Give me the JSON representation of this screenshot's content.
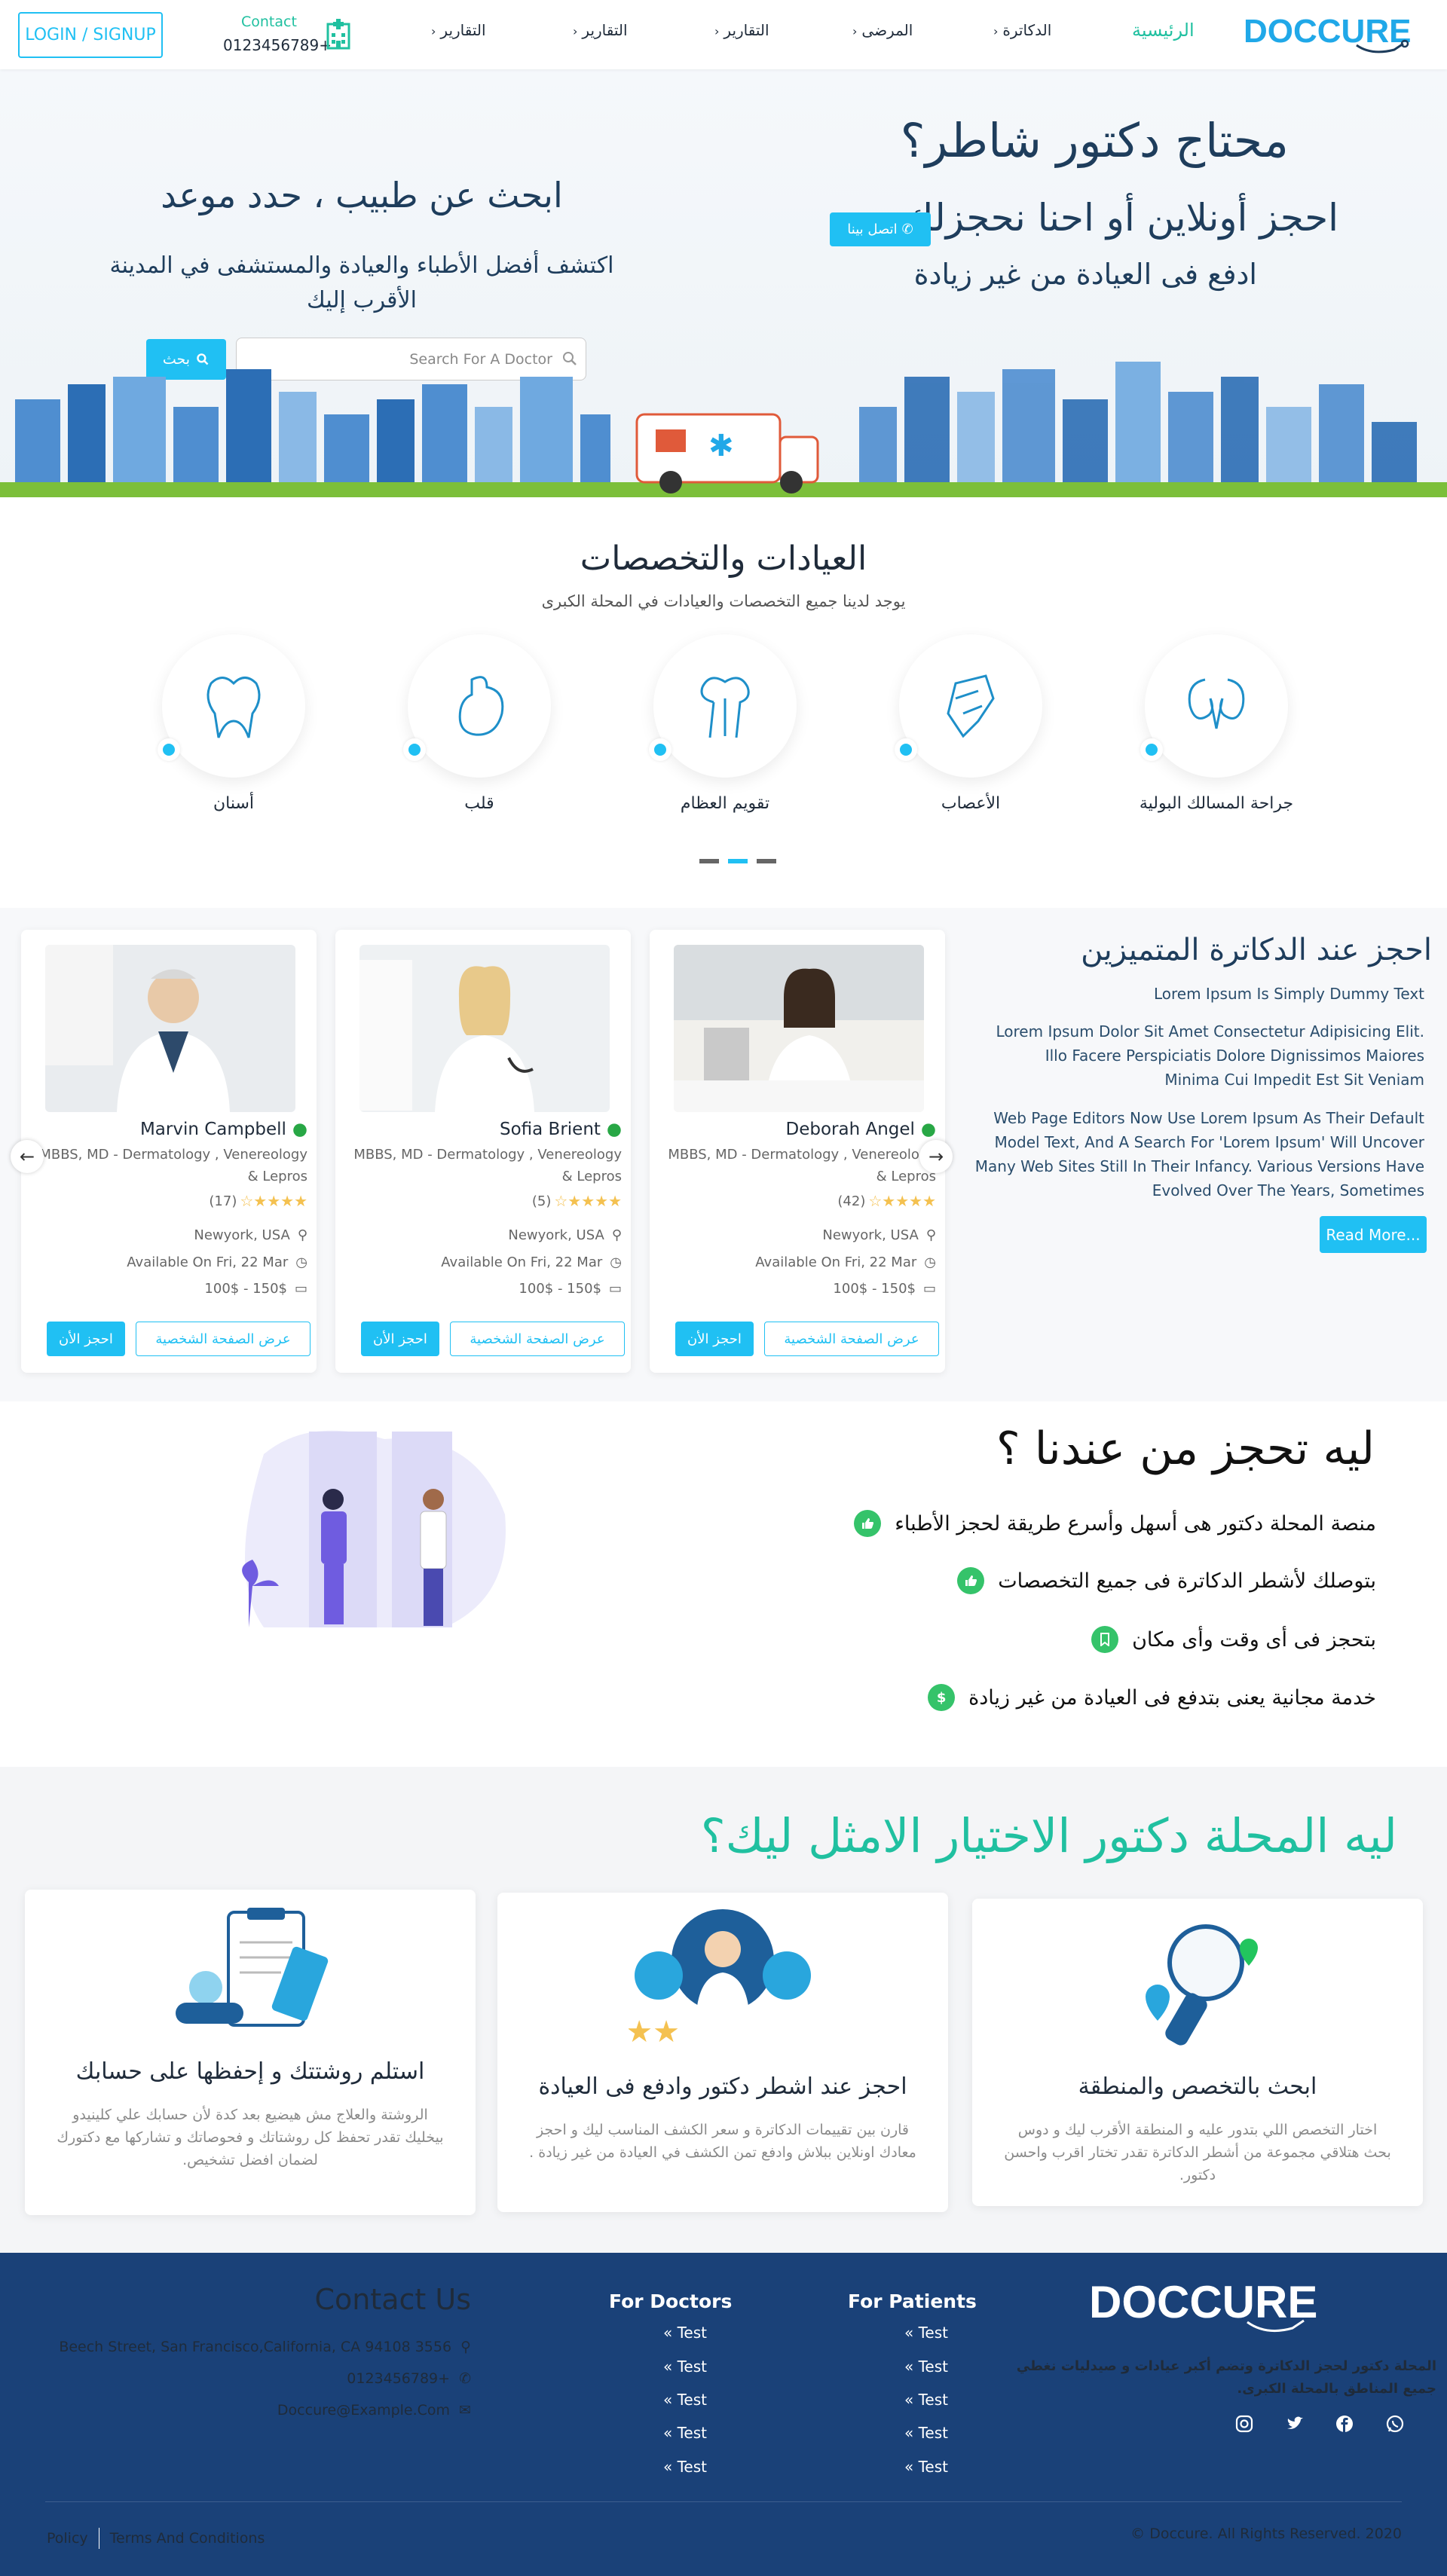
{
  "header": {
    "login_label": "LOGIN / SIGNUP",
    "contact_label": "Contact",
    "contact_phone": "0123456789+",
    "nav": [
      {
        "label": "التقارير"
      },
      {
        "label": "التقارير"
      },
      {
        "label": "التقارير"
      },
      {
        "label": "المرضى"
      },
      {
        "label": "الدكاترة"
      }
    ],
    "home_label": "الرئيسية",
    "logo_text": "DOCCURE"
  },
  "hero": {
    "title": "محتاج دكتور شاطر؟",
    "subtitle": "احجز أونلاين أو احنا نحجزلك",
    "subtitle2": "ادفع فى العيادة من غير زيادة",
    "call_label": "اتصل بينا",
    "search_title": "ابحث عن طبيب ، حدد موعد",
    "search_desc": "اكتشف أفضل الأطباء والعيادة والمستشفى في المدينة الأقرب إليك",
    "search_placeholder": "Search For A Doctor",
    "search_button": "بحث"
  },
  "specialties": {
    "title": "العيادات والتخصصات",
    "subtitle": "يوجد لدينا جميع التخصصات والعيادات في المحلة الكبرى",
    "items": [
      {
        "label": "أسنان",
        "icon": "teeth-icon"
      },
      {
        "label": "قلب",
        "icon": "heart-organ-icon"
      },
      {
        "label": "تقويم العظام",
        "icon": "bone-icon"
      },
      {
        "label": "الأعصاب",
        "icon": "brain-icon"
      },
      {
        "label": "جراحة المسالك البولية",
        "icon": "kidney-icon"
      }
    ]
  },
  "doctors": {
    "heading": "احجز عند الدكاترة المتميزين",
    "p1": "Lorem Ipsum Is Simply Dummy Text",
    "p2": "Lorem Ipsum Dolor Sit Amet Consectetur Adipisicing Elit. Illo Facere Perspiciatis Dolore Dignissimos Maiores Minima Cui Impedit Est Sit Veniam",
    "p3": "Web Page Editors Now Use Lorem Ipsum As Their Default Model Text, And A Search For 'Lorem Ipsum' Will Uncover Many Web Sites Still In Their Infancy. Various Versions Have Evolved Over The Years, Sometimes",
    "read_more": "Read More...",
    "cards": [
      {
        "name": "Marvin Campbell",
        "spec": "MBBS, MD - Dermatology , Venereology & Lepros",
        "reviews": "(17)",
        "stars": 4,
        "location": "Newyork, USA",
        "available": "Available On Fri, 22 Mar",
        "price": "100$ - 150$",
        "profile": "عرض الصفحة الشخصية",
        "book": "احجز الأن"
      },
      {
        "name": "Sofia Brient",
        "spec": "MBBS, MD - Dermatology , Venereology & Lepros",
        "reviews": "(5)",
        "stars": 4,
        "location": "Newyork, USA",
        "available": "Available On Fri, 22 Mar",
        "price": "100$ - 150$",
        "profile": "عرض الصفحة الشخصية",
        "book": "احجز الأن"
      },
      {
        "name": "Deborah Angel",
        "spec": "MBBS, MD - Dermatology , Venereology & Lepros",
        "reviews": "(42)",
        "stars": 4,
        "location": "Newyork, USA",
        "available": "Available On Fri, 22 Mar",
        "price": "100$ - 150$",
        "profile": "عرض الصفحة الشخصية",
        "book": "احجز الأن"
      }
    ]
  },
  "why": {
    "title": "ليه تحجز من عندنا ؟",
    "items": [
      "منصة المحلة دكتور هى أسهل وأسرع طريقة لحجز الأطباء",
      "بتوصلك لأشطر الدكاترة فى جميع التخصصات",
      "بتحجز فى أى وقت وأى مكان",
      "خدمة مجانية يعنى بتدفع فى العيادة من غير زيادة"
    ]
  },
  "best": {
    "title": "ليه المحلة دكتور الاختيار الامثل ليك؟",
    "cards": [
      {
        "title": "استلم روشتتك و إحفظها على حسابك",
        "text": "الروشتة والعلاج مش هيضيع بعد كدة لأن حسابك علي كلينيدو بيخليك تقدر تحفظ كل روشتاتك و فحوصاتك و تشاركها مع دكتورك لضمان افضل تشخيص."
      },
      {
        "title": "احجز عند اشطر دكتور وادفع فى العيادة",
        "text": "قارن بين تقييمات الدكاترة و سعر الكشف المناسب ليك و احجز معادك اونلاين ببلاش وادفع تمن الكشف في العيادة من غير زيادة ."
      },
      {
        "title": "ابحث بالتخصص والمنطقة",
        "text": "اختار التخصص اللي بتدور عليه و المنطقة الأقرب ليك و دوس بحث هتلاقي مجموعة من أشطر الدكاترة تقدر تختار اقرب واحسن دكتور."
      }
    ]
  },
  "footer": {
    "logo_text": "DOCCURE",
    "description": "المحلة دكتور لحجز الدكاترة وتضم أكبر عيادات و صيدليات نغطي جميع المناطق بالمحلة الكبرى.",
    "patients_head": "For Patients",
    "doctors_head": "For Doctors",
    "links": [
      "Test",
      "Test",
      "Test",
      "Test",
      "Test"
    ],
    "contact_head": "Contact Us",
    "address": "Beech Street, San Francisco,California, CA 94108 3556",
    "phone": "0123456789+",
    "email": "Doccure@Example.Com",
    "copyright": "© Doccure. All Rights Reserved. 2020",
    "policy": "Policy",
    "terms": "Terms And Conditions"
  },
  "colors": {
    "accent": "#20c0f3",
    "green": "#20c0a0",
    "navy": "#1e3d5c",
    "footer": "#1a4178"
  }
}
